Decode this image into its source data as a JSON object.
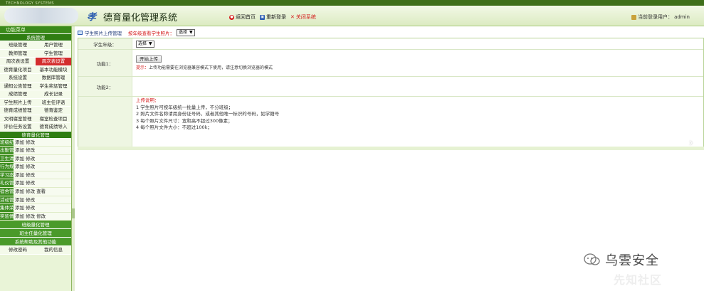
{
  "topstrip": {
    "text": "TECHNOLOGY SYSTEMS"
  },
  "header": {
    "logo_glyph": "孝",
    "title": "德育量化管理系统",
    "links": [
      {
        "label": "返回首页",
        "color": "#d41a1a"
      },
      {
        "label": "重新登录",
        "color": "#2d5eb0"
      },
      {
        "label": "关闭系统",
        "color": "#d41a1a"
      }
    ],
    "user_label": "当前登录用户：",
    "user_name": "admin"
  },
  "sidebar": {
    "title": "功能菜单",
    "sections": [
      {
        "title": "系统管理",
        "items": [
          "班级管理",
          "用户管理",
          "教师管理",
          "学生管理",
          "周次表设置",
          "周次表设置",
          "德育量化项目",
          "基本功能模块",
          "系统设置",
          "数据库管理",
          "通知公告管理",
          "学生奖惩管理",
          "成绩管理",
          "成长记录",
          "学生照片上传",
          "班主任评语",
          "德育成绩管理",
          "德育鉴定",
          "文明寝室管理",
          "寝室检查项目",
          "评价任务设置",
          "德育成绩导入"
        ],
        "active_index": 5
      },
      {
        "title": "德育量化管理",
        "rows": [
          {
            "tag": "班级纪律",
            "actions": "添加 修改"
          },
          {
            "tag": "出勤管理",
            "actions": "添加 修改"
          },
          {
            "tag": "卫生清洁",
            "actions": "添加 修改"
          },
          {
            "tag": "行为规范",
            "actions": "添加 修改"
          },
          {
            "tag": "学习态度",
            "actions": "添加 修改"
          },
          {
            "tag": "礼仪管理",
            "actions": "添加 修改"
          },
          {
            "tag": "宿舍管理",
            "actions": "添加 修改 查看"
          },
          {
            "tag": "活动管理",
            "actions": "添加 修改"
          },
          {
            "tag": "集体荣誉",
            "actions": "添加 修改"
          },
          {
            "tag": "奖惩情况",
            "actions": "添加 修改 修改"
          }
        ]
      },
      {
        "title": "班级量化管理"
      },
      {
        "title": "班主任量化管理"
      },
      {
        "title": "系统帮助及其他功能"
      }
    ],
    "bottom_items": [
      "修改密码",
      "我的信息"
    ]
  },
  "main": {
    "crumb_label": "学生照片上传管理",
    "crumb_red": "按年级查看学生照片：",
    "grade_select": "选择",
    "rows": {
      "grade_label": "学生年级：",
      "grade_select": "选择",
      "func1_label": "功能1：",
      "upload_button": "开始上传",
      "tip_prefix": "提示：",
      "tip_text": "上传功能需要在浏览器兼容模式下使用，请注意切换浏览器的模式",
      "func2_label": "功能2：",
      "instr_title": "上传说明：",
      "instr_items": [
        "1 学生照片可按年级统一批量上传，不分班级；",
        "2 照片文件名称请用身份证号码，或者其他唯一标识的号码，如学籍号",
        "3 每个照片文件尺寸：宽和高不超过300像素；",
        "4 每个照片文件大小：不超过100k；"
      ]
    }
  },
  "watermark": {
    "main": "乌雲安全",
    "sub": "先知社区"
  }
}
